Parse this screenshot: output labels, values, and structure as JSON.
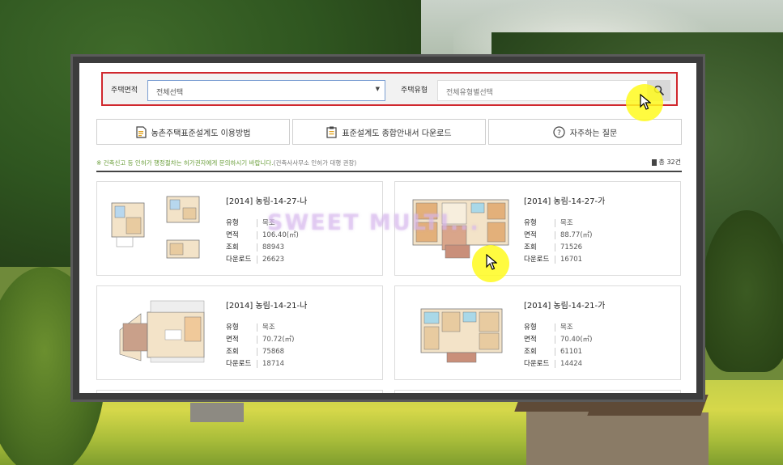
{
  "search": {
    "area_label": "주택면적",
    "area_value": "전체선택",
    "type_label": "주택유형",
    "type_placeholder": "전체유형별선택"
  },
  "actions": [
    {
      "label": "농촌주택표준설계도 이용방법",
      "icon": "document-icon"
    },
    {
      "label": "표준설계도 종합안내서 다운로드",
      "icon": "clipboard-icon"
    },
    {
      "label": "자주하는 질문",
      "icon": "question-icon"
    }
  ],
  "notice": {
    "text": "※ 건축신고 등 인허가 행정절차는 허가권자에게 문의하시기 바랍니다.",
    "sub": "(건축사사무소 인허가 대행 권장)"
  },
  "total": "총 32건",
  "field_labels": {
    "type": "유형",
    "area": "면적",
    "views": "조회",
    "downloads": "다운로드"
  },
  "cards": [
    {
      "title": "[2014] 농림-14-27-나",
      "type": "목조",
      "area": "106.40(㎡)",
      "views": "88943",
      "downloads": "26623"
    },
    {
      "title": "[2014] 농림-14-27-가",
      "type": "목조",
      "area": "88.77(㎡)",
      "views": "71526",
      "downloads": "16701"
    },
    {
      "title": "[2014] 농림-14-21-나",
      "type": "목조",
      "area": "70.72(㎡)",
      "views": "75868",
      "downloads": "18714"
    },
    {
      "title": "[2014] 농림-14-21-가",
      "type": "목조",
      "area": "70.40(㎡)",
      "views": "61101",
      "downloads": "14424"
    }
  ],
  "watermark": "SWEET MULTI...",
  "colors": {
    "highlight_border": "#d0282e",
    "notice_green": "#6a9e3a",
    "cursor_highlight": "#fffa1e"
  }
}
